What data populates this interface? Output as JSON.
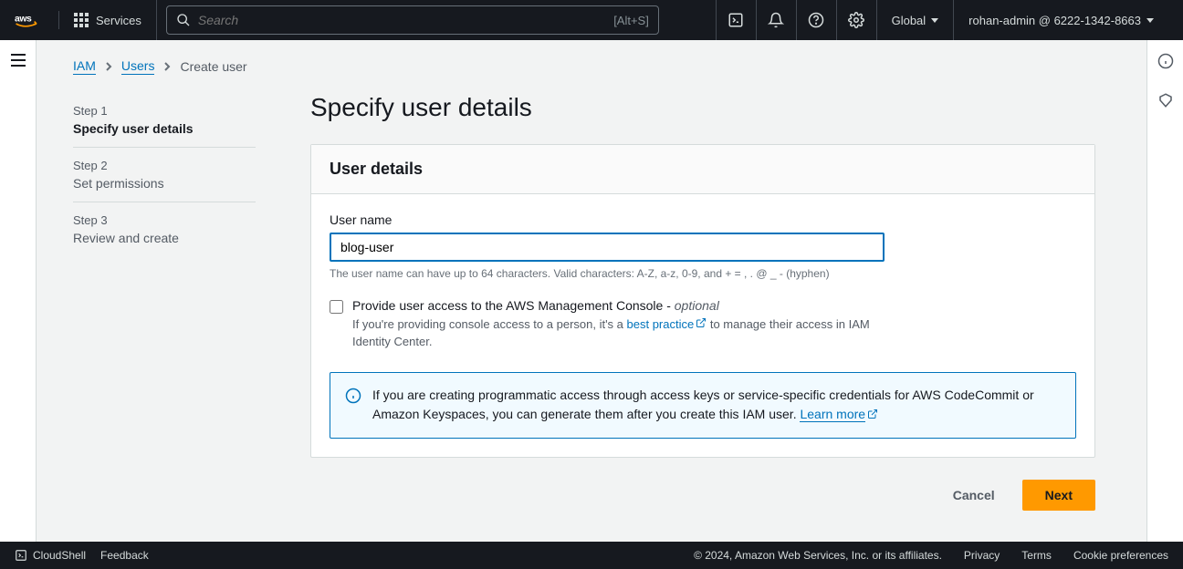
{
  "nav": {
    "services_label": "Services",
    "search_placeholder": "Search",
    "search_shortcut": "[Alt+S]",
    "region": "Global",
    "account": "rohan-admin @ 6222-1342-8663"
  },
  "breadcrumb": {
    "iam": "IAM",
    "users": "Users",
    "current": "Create user"
  },
  "steps": [
    {
      "num": "Step 1",
      "title": "Specify user details"
    },
    {
      "num": "Step 2",
      "title": "Set permissions"
    },
    {
      "num": "Step 3",
      "title": "Review and create"
    }
  ],
  "page": {
    "title": "Specify user details",
    "card_title": "User details",
    "username_label": "User name",
    "username_value": "blog-user",
    "username_hint": "The user name can have up to 64 characters. Valid characters: A-Z, a-z, 0-9, and + = , . @ _ - (hyphen)",
    "console_access_label": "Provide user access to the AWS Management Console - ",
    "optional": "optional",
    "console_access_sub_1": "If you're providing console access to a person, it's a ",
    "best_practice": "best practice",
    "console_access_sub_2": " to manage their access in IAM Identity Center.",
    "info_text": "If you are creating programmatic access through access keys or service-specific credentials for AWS CodeCommit or Amazon Keyspaces, you can generate them after you create this IAM user. ",
    "learn_more": "Learn more",
    "cancel": "Cancel",
    "next": "Next"
  },
  "footer": {
    "cloudshell": "CloudShell",
    "feedback": "Feedback",
    "copyright": "© 2024, Amazon Web Services, Inc. or its affiliates.",
    "privacy": "Privacy",
    "terms": "Terms",
    "cookie": "Cookie preferences"
  }
}
